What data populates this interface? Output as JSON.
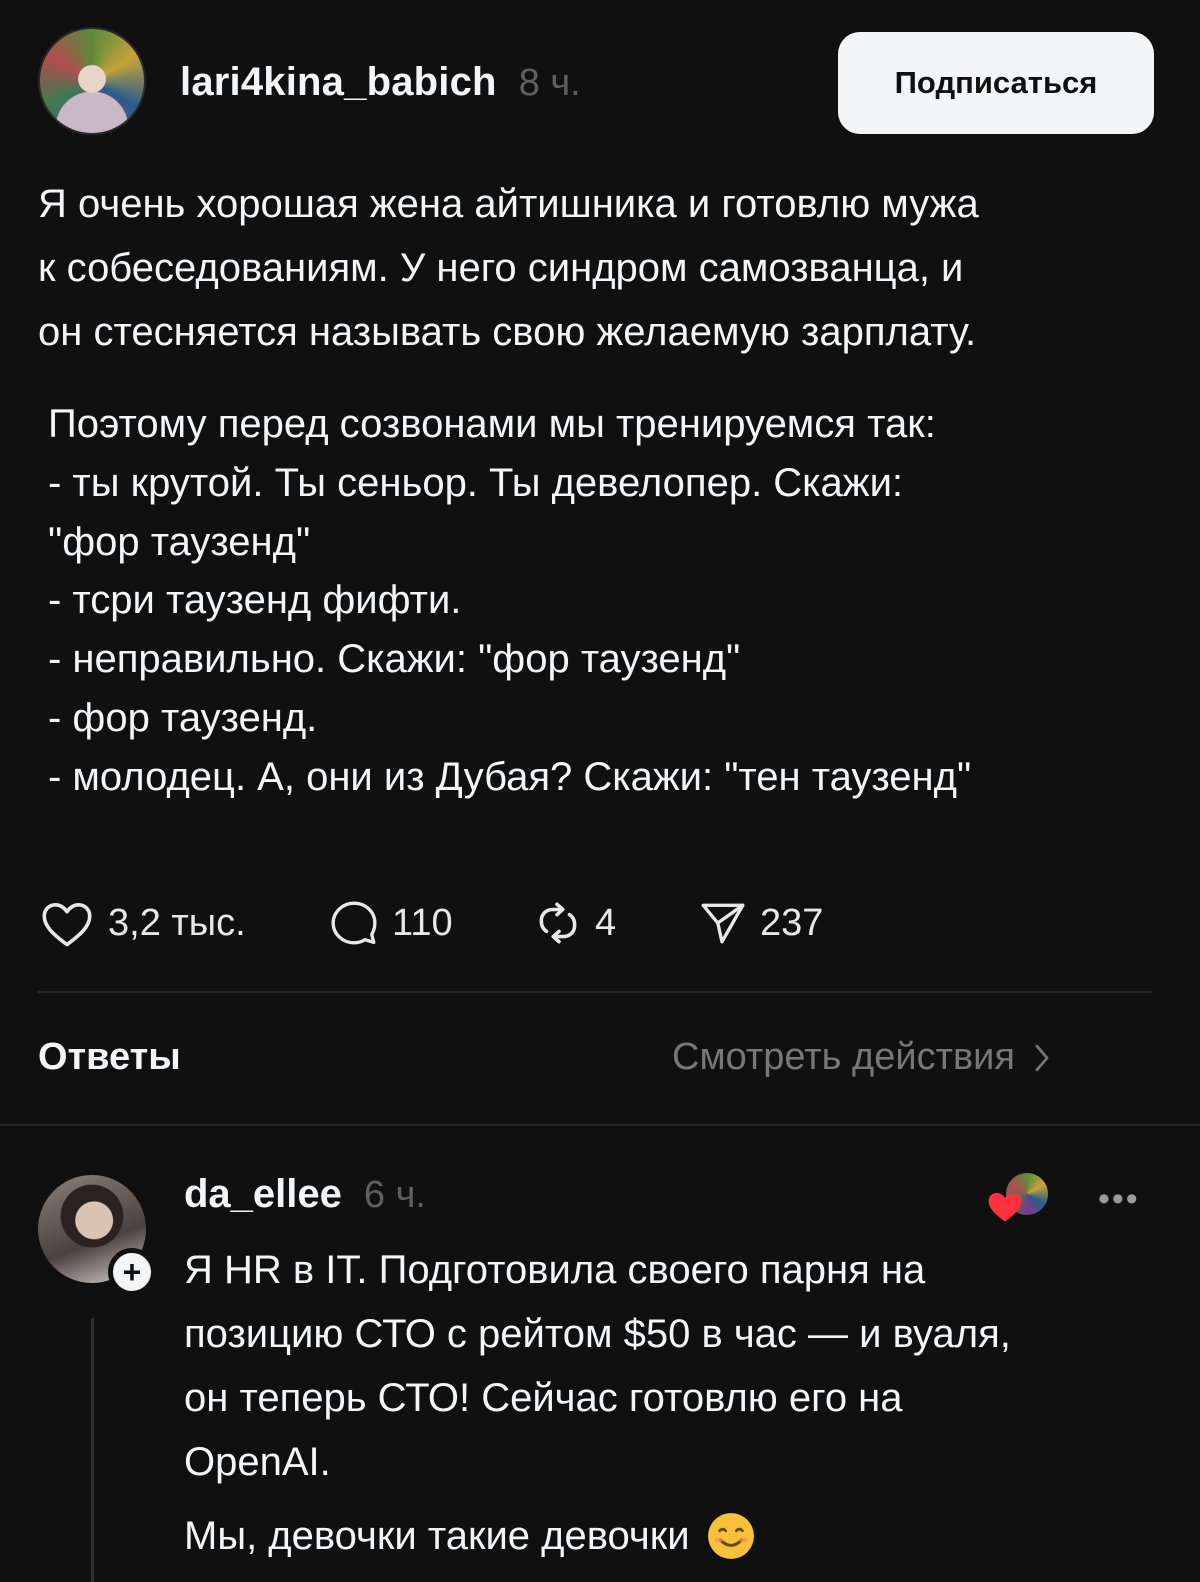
{
  "post": {
    "username": "lari4kina_babich",
    "time": "8 ч.",
    "follow_label": "Подписаться",
    "paragraph1": [
      "Я очень хорошая жена айтишника и готовлю мужа",
      "к собеседованиям. У него синдром самозванца, и",
      "он стесняется называть свою желаемую зарплату."
    ],
    "paragraph2": [
      "Поэтому перед созвонами мы тренируемся так:",
      "- ты крутой. Ты сеньор. Ты девелопер. Скажи:",
      "\"фор таузенд\"",
      "- тсри таузенд фифти.",
      "- неправильно. Скажи: \"фор таузенд\"",
      "- фор таузенд.",
      "- молодец. А, они из Дубая? Скажи: \"тен таузенд\""
    ],
    "actions": {
      "likes": "3,2 тыс.",
      "comments": "110",
      "reposts": "4",
      "shares": "237"
    }
  },
  "replies_section": {
    "title": "Ответы",
    "view_activity": "Смотреть действия"
  },
  "reply": {
    "username": "da_ellee",
    "time": "6 ч.",
    "follow_plus": "+",
    "more": "•••",
    "lines": [
      "Я HR в IT. Подготовила своего парня на",
      "позицию СТО с рейтом $50 в час — и вуаля,",
      "он теперь СТО! Сейчас готовлю его на",
      "OpenAI."
    ],
    "last_line": "Мы, девочки такие девочки"
  },
  "icons": {
    "like": "heart-outline-icon",
    "comment": "speech-bubble-icon",
    "repost": "repost-arrows-icon",
    "share": "paper-plane-icon",
    "chevron": "chevron-right-icon",
    "liked_badge": "red-heart-icon",
    "emoji": "smiling-face-icon"
  },
  "colors": {
    "background": "#101010",
    "text": "#f3f5f7",
    "muted": "#777777",
    "heart": "#ff3040"
  }
}
